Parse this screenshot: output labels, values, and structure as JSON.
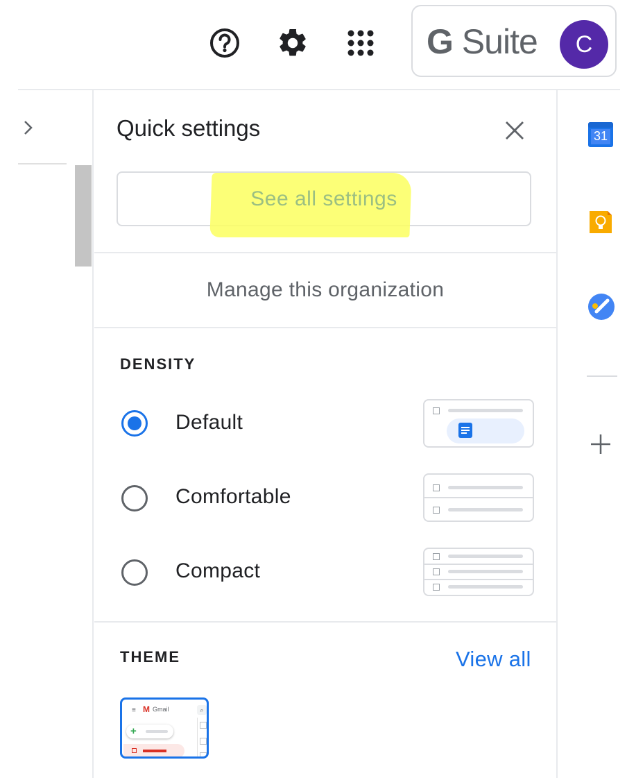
{
  "header": {
    "help_icon": "help-circle-icon",
    "settings_icon": "gear-icon",
    "apps_icon": "apps-grid-icon",
    "brand": {
      "g": "G",
      "suite": " Suite"
    },
    "avatar_letter": "C",
    "avatar_color": "#5429a8"
  },
  "quick_settings": {
    "title": "Quick settings",
    "see_all_label": "See all settings",
    "manage_label": "Manage this organization",
    "density": {
      "heading": "DENSITY",
      "options": [
        {
          "label": "Default",
          "selected": true
        },
        {
          "label": "Comfortable",
          "selected": false
        },
        {
          "label": "Compact",
          "selected": false
        }
      ]
    },
    "theme": {
      "heading": "THEME",
      "view_all": "View all",
      "thumbnail_app": "Gmail"
    }
  },
  "right_sidebar": {
    "calendar_day": "31",
    "icons": [
      "calendar-icon",
      "keep-icon",
      "tasks-icon",
      "add-icon"
    ]
  },
  "colors": {
    "accent": "#1a73e8",
    "highlight": "#fbff5f",
    "highlight_text": "#9bbf82"
  }
}
